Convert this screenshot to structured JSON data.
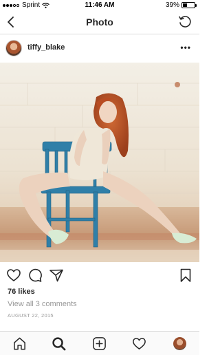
{
  "status_bar": {
    "carrier": "Sprint",
    "time": "11:46 AM",
    "battery": "39%",
    "battery_level": 0.39
  },
  "nav": {
    "title": "Photo",
    "back_icon": "chevron-left-icon",
    "refresh_icon": "refresh-icon"
  },
  "post": {
    "username": "tiffy_blake",
    "more_label": "•••",
    "likes": "76 likes",
    "comments_link": "View all 3 comments",
    "date": "AUGUST 22, 2015"
  },
  "tab_bar": {
    "items": [
      "home-icon",
      "search-icon",
      "add-post-icon",
      "activity-heart-icon",
      "profile-avatar"
    ]
  },
  "colors": {
    "text": "#262626",
    "muted": "#999999",
    "divider": "#dbdbdb",
    "chair": "#2f7fa8"
  }
}
